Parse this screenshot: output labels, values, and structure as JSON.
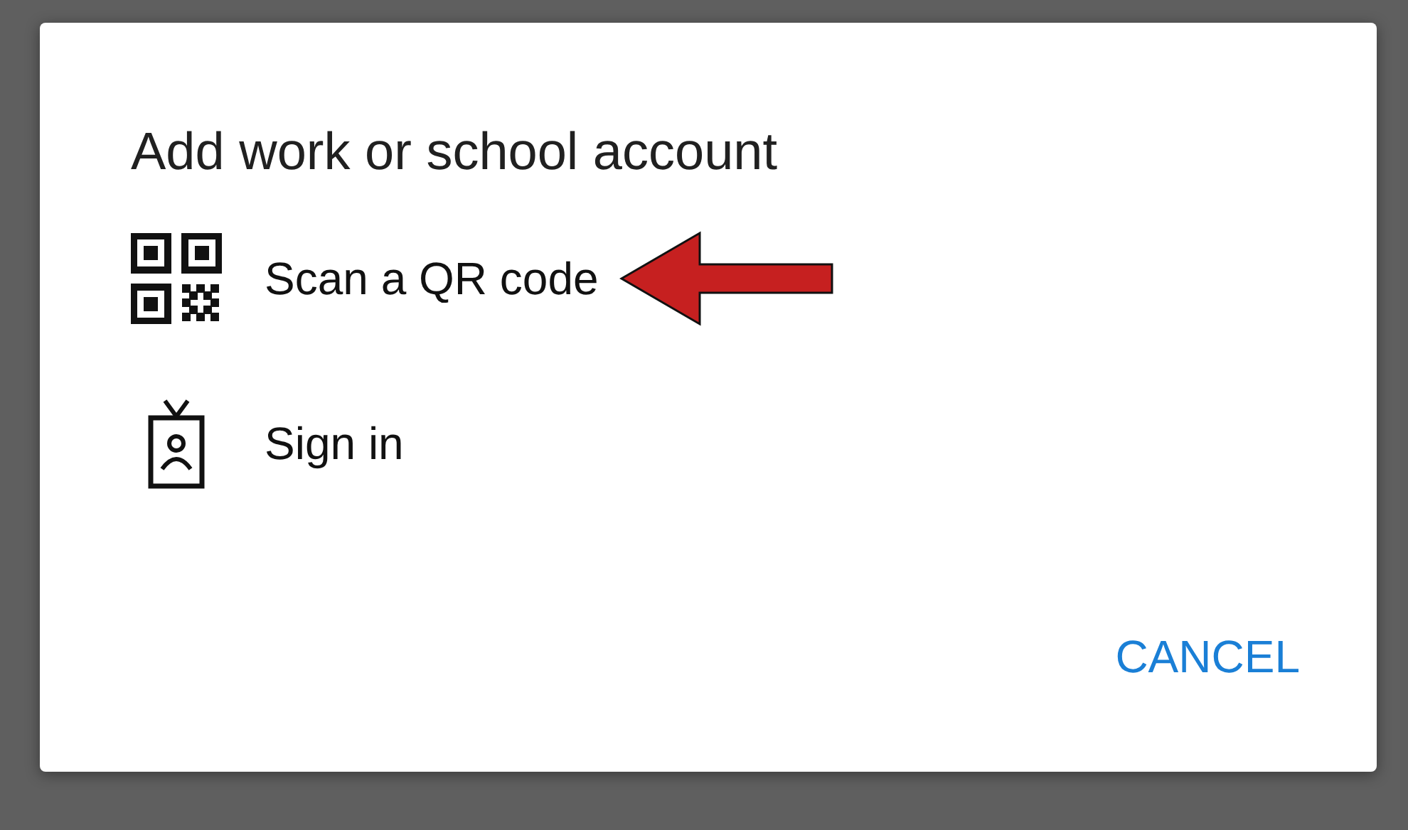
{
  "dialog": {
    "title": "Add work or school account",
    "options": [
      {
        "kind": "qr",
        "label": "Scan a QR code",
        "pointer": true
      },
      {
        "kind": "badge",
        "label": "Sign in",
        "pointer": false
      }
    ],
    "buttons": [
      "CANCEL"
    ]
  }
}
